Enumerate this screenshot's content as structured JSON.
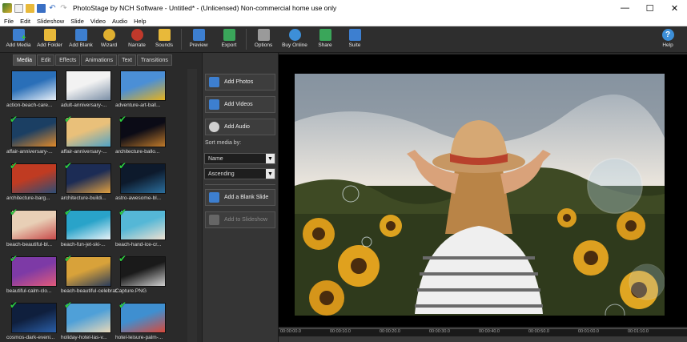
{
  "window": {
    "title": "PhotoStage by NCH Software - Untitled* - (Unlicensed) Non-commercial home use only",
    "controls": [
      "—",
      "☐",
      "✕"
    ]
  },
  "menu": [
    "File",
    "Edit",
    "Slideshow",
    "Slide",
    "Video",
    "Audio",
    "Help"
  ],
  "toolbar": {
    "add_media": "Add Media",
    "add_folder": "Add Folder",
    "add_blank": "Add Blank",
    "wizard": "Wizard",
    "narrate": "Narrate",
    "sounds": "Sounds",
    "preview": "Preview",
    "export": "Export",
    "options": "Options",
    "buy_online": "Buy Online",
    "share": "Share",
    "suite": "Suite",
    "help": "Help"
  },
  "tabs": [
    "Media",
    "Edit",
    "Effects",
    "Animations",
    "Text",
    "Transitions"
  ],
  "media": [
    {
      "name": "action-beach-care...",
      "checked": false,
      "c1": "#2a6fb8",
      "c2": "#e9f0f8"
    },
    {
      "name": "adult-anniversary-...",
      "checked": false,
      "c1": "#f2f2f2",
      "c2": "#7b8fa6"
    },
    {
      "name": "adventure-art-ball...",
      "checked": false,
      "c1": "#4b8fd6",
      "c2": "#e6b21c"
    },
    {
      "name": "affair-anniversary-...",
      "checked": true,
      "c1": "#1b3f63",
      "c2": "#e08a2a"
    },
    {
      "name": "affair-anniversary-...",
      "checked": true,
      "c1": "#e9c07a",
      "c2": "#4fa3c7"
    },
    {
      "name": "architecture-ballo...",
      "checked": true,
      "c1": "#0b0b16",
      "c2": "#c07a2a"
    },
    {
      "name": "architecture-barg...",
      "checked": true,
      "c1": "#c03b22",
      "c2": "#2c4d76"
    },
    {
      "name": "architecture-buildi...",
      "checked": true,
      "c1": "#1c2c55",
      "c2": "#e0a040"
    },
    {
      "name": "astro-awesome-bl...",
      "checked": true,
      "c1": "#0d1a2c",
      "c2": "#2b6f9e"
    },
    {
      "name": "beach-beautiful-bl...",
      "checked": true,
      "c1": "#e8cfb6",
      "c2": "#c84a4a"
    },
    {
      "name": "beach-fun-jet-ski-...",
      "checked": true,
      "c1": "#29a3c9",
      "c2": "#e8f3f8"
    },
    {
      "name": "beach-hand-ice-cr...",
      "checked": true,
      "c1": "#55b7d6",
      "c2": "#efe1d2"
    },
    {
      "name": "beautiful-calm-clo...",
      "checked": true,
      "c1": "#7d3aa6",
      "c2": "#e25a7a"
    },
    {
      "name": "beach-beautiful-celebrati...",
      "checked": true,
      "c1": "#d8a23a",
      "c2": "#2a3c5a"
    },
    {
      "name": "Capture.PNG",
      "checked": true,
      "c1": "#1a1a1a",
      "c2": "#d0d0d0"
    },
    {
      "name": "cosmos-dark-eveni...",
      "checked": true,
      "c1": "#0f1f3d",
      "c2": "#2a5fa8"
    },
    {
      "name": "holiday-hotel-las-v...",
      "checked": true,
      "c1": "#4fa0d8",
      "c2": "#e8d8b8"
    },
    {
      "name": "hotel-leisure-palm-...",
      "checked": true,
      "c1": "#3f8fd0",
      "c2": "#d8493a"
    }
  ],
  "middle": {
    "add_photos": "Add Photos",
    "add_videos": "Add Videos",
    "add_audio": "Add Audio",
    "sort_label": "Sort media by:",
    "sort_by": "Name",
    "sort_order": "Ascending",
    "add_blank_slide": "Add a Blank Slide",
    "add_to_slideshow": "Add to Slideshow"
  },
  "timeline": [
    "00:00:00.0",
    "00:00:10.0",
    "00:00:20.0",
    "00:00:30.0",
    "00:00:40.0",
    "00:00:50.0",
    "00:01:00.0",
    "00:01:10.0"
  ]
}
